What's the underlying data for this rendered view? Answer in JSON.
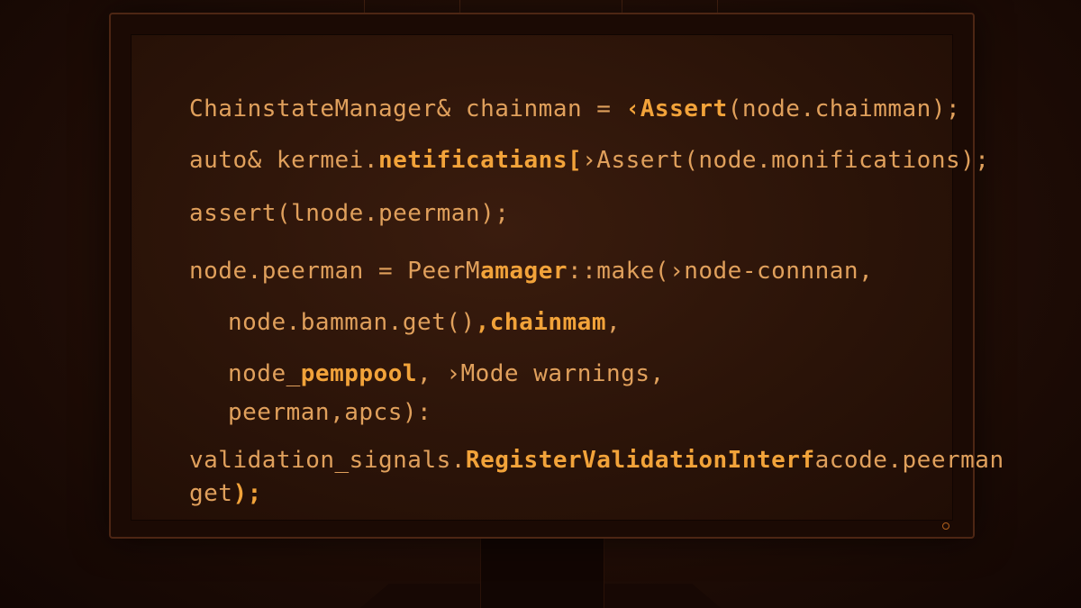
{
  "colors": {
    "background": "#1a0904",
    "code_text": "#e0a05c",
    "code_highlight": "#f2a33a",
    "bezel": "#4d2614"
  },
  "code": {
    "lines": [
      {
        "segments": [
          {
            "text": "ChainstateManager& chainman = ",
            "hl": false
          },
          {
            "text": "‹Assert",
            "hl": true
          },
          {
            "text": "(node.chaimman);",
            "hl": false
          }
        ]
      },
      {
        "segments": [
          {
            "text": "auto& kermei.",
            "hl": false
          },
          {
            "text": "netificatians[",
            "hl": true
          },
          {
            "text": "›Assert(node.monifications);",
            "hl": false
          }
        ]
      },
      {
        "segments": [
          {
            "text": "assert(lnode.peerman);",
            "hl": false
          }
        ]
      },
      {
        "segments": [
          {
            "text": "node.peerman = PeerM",
            "hl": false
          },
          {
            "text": "amager",
            "hl": true
          },
          {
            "text": "::make(›node-connnan,",
            "hl": false
          }
        ]
      },
      {
        "segments": [
          {
            "text": "node.bamman.get()",
            "hl": false
          },
          {
            "text": ",chainmam",
            "hl": true
          },
          {
            "text": ",",
            "hl": false
          }
        ]
      },
      {
        "segments": [
          {
            "text": "node_",
            "hl": false
          },
          {
            "text": "pemppool",
            "hl": true
          },
          {
            "text": ", ›Mode warnings,",
            "hl": false
          }
        ]
      },
      {
        "segments": [
          {
            "text": "peerman,ap",
            "hl": false
          },
          {
            "text": "cs):",
            "hl": false
          }
        ]
      },
      {
        "segments": [
          {
            "text": "validation_signals.",
            "hl": false
          },
          {
            "text": "RegisterValidationInterf",
            "hl": true
          },
          {
            "text": "acode.peerman",
            "hl": false
          }
        ]
      },
      {
        "segments": [
          {
            "text": "get",
            "hl": false
          },
          {
            "text": ");",
            "hl": true
          }
        ]
      }
    ]
  }
}
